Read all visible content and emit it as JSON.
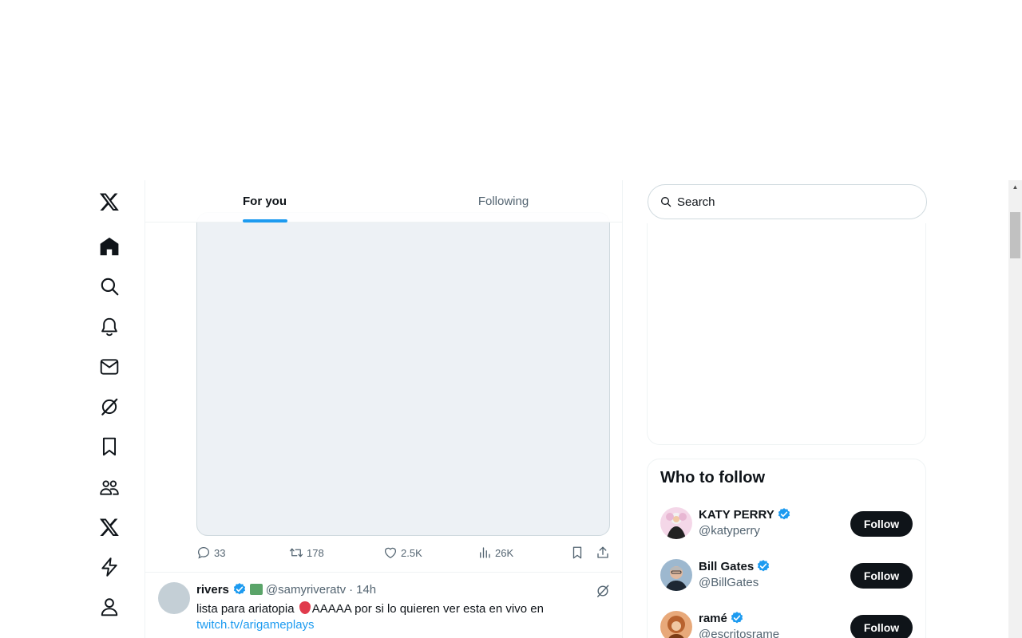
{
  "nav": {
    "items": [
      {
        "icon": "x-logo-icon"
      },
      {
        "icon": "home-icon"
      },
      {
        "icon": "search-icon"
      },
      {
        "icon": "notifications-icon"
      },
      {
        "icon": "messages-icon"
      },
      {
        "icon": "grok-icon"
      },
      {
        "icon": "bookmarks-icon"
      },
      {
        "icon": "communities-icon"
      },
      {
        "icon": "premium-icon"
      },
      {
        "icon": "verified-orgs-icon"
      },
      {
        "icon": "profile-icon"
      }
    ]
  },
  "tabs": [
    {
      "label": "For you",
      "active": true
    },
    {
      "label": "Following",
      "active": false
    }
  ],
  "tweet1": {
    "replies": "33",
    "reposts": "178",
    "likes": "2.5K",
    "views": "26K"
  },
  "tweet2": {
    "name": "rivers",
    "handle": "@samyriveratv",
    "separator": "·",
    "time": "14h",
    "text_before": "lista para ariatopia",
    "text_after": "AAAAA por si lo quieren ver esta en vivo en",
    "link": "twitch.tv/arigameplays"
  },
  "search": {
    "placeholder": "Search"
  },
  "who_to_follow": {
    "title": "Who to follow",
    "follow_label": "Follow",
    "accounts": [
      {
        "name": "KATY PERRY",
        "handle": "@katyperry"
      },
      {
        "name": "Bill Gates",
        "handle": "@BillGates"
      },
      {
        "name": "ramé",
        "handle": "@escritosrame"
      }
    ]
  },
  "colors": {
    "accent": "#1d9bf0",
    "text": "#0f1419",
    "muted": "#536471",
    "button": "#0f1419"
  }
}
